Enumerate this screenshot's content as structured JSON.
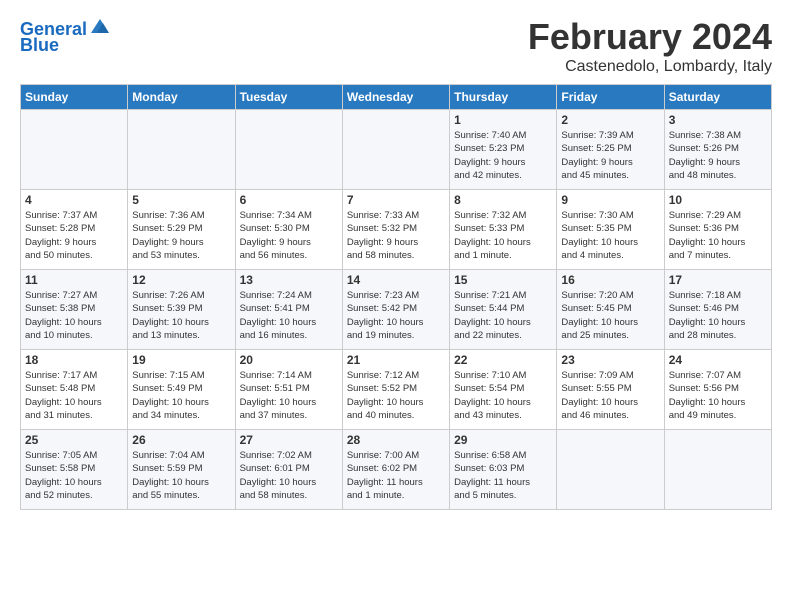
{
  "header": {
    "logo_line1": "General",
    "logo_line2": "Blue",
    "month_title": "February 2024",
    "location": "Castenedolo, Lombardy, Italy"
  },
  "weekdays": [
    "Sunday",
    "Monday",
    "Tuesday",
    "Wednesday",
    "Thursday",
    "Friday",
    "Saturday"
  ],
  "weeks": [
    [
      {
        "day": "",
        "info": ""
      },
      {
        "day": "",
        "info": ""
      },
      {
        "day": "",
        "info": ""
      },
      {
        "day": "",
        "info": ""
      },
      {
        "day": "1",
        "info": "Sunrise: 7:40 AM\nSunset: 5:23 PM\nDaylight: 9 hours\nand 42 minutes."
      },
      {
        "day": "2",
        "info": "Sunrise: 7:39 AM\nSunset: 5:25 PM\nDaylight: 9 hours\nand 45 minutes."
      },
      {
        "day": "3",
        "info": "Sunrise: 7:38 AM\nSunset: 5:26 PM\nDaylight: 9 hours\nand 48 minutes."
      }
    ],
    [
      {
        "day": "4",
        "info": "Sunrise: 7:37 AM\nSunset: 5:28 PM\nDaylight: 9 hours\nand 50 minutes."
      },
      {
        "day": "5",
        "info": "Sunrise: 7:36 AM\nSunset: 5:29 PM\nDaylight: 9 hours\nand 53 minutes."
      },
      {
        "day": "6",
        "info": "Sunrise: 7:34 AM\nSunset: 5:30 PM\nDaylight: 9 hours\nand 56 minutes."
      },
      {
        "day": "7",
        "info": "Sunrise: 7:33 AM\nSunset: 5:32 PM\nDaylight: 9 hours\nand 58 minutes."
      },
      {
        "day": "8",
        "info": "Sunrise: 7:32 AM\nSunset: 5:33 PM\nDaylight: 10 hours\nand 1 minute."
      },
      {
        "day": "9",
        "info": "Sunrise: 7:30 AM\nSunset: 5:35 PM\nDaylight: 10 hours\nand 4 minutes."
      },
      {
        "day": "10",
        "info": "Sunrise: 7:29 AM\nSunset: 5:36 PM\nDaylight: 10 hours\nand 7 minutes."
      }
    ],
    [
      {
        "day": "11",
        "info": "Sunrise: 7:27 AM\nSunset: 5:38 PM\nDaylight: 10 hours\nand 10 minutes."
      },
      {
        "day": "12",
        "info": "Sunrise: 7:26 AM\nSunset: 5:39 PM\nDaylight: 10 hours\nand 13 minutes."
      },
      {
        "day": "13",
        "info": "Sunrise: 7:24 AM\nSunset: 5:41 PM\nDaylight: 10 hours\nand 16 minutes."
      },
      {
        "day": "14",
        "info": "Sunrise: 7:23 AM\nSunset: 5:42 PM\nDaylight: 10 hours\nand 19 minutes."
      },
      {
        "day": "15",
        "info": "Sunrise: 7:21 AM\nSunset: 5:44 PM\nDaylight: 10 hours\nand 22 minutes."
      },
      {
        "day": "16",
        "info": "Sunrise: 7:20 AM\nSunset: 5:45 PM\nDaylight: 10 hours\nand 25 minutes."
      },
      {
        "day": "17",
        "info": "Sunrise: 7:18 AM\nSunset: 5:46 PM\nDaylight: 10 hours\nand 28 minutes."
      }
    ],
    [
      {
        "day": "18",
        "info": "Sunrise: 7:17 AM\nSunset: 5:48 PM\nDaylight: 10 hours\nand 31 minutes."
      },
      {
        "day": "19",
        "info": "Sunrise: 7:15 AM\nSunset: 5:49 PM\nDaylight: 10 hours\nand 34 minutes."
      },
      {
        "day": "20",
        "info": "Sunrise: 7:14 AM\nSunset: 5:51 PM\nDaylight: 10 hours\nand 37 minutes."
      },
      {
        "day": "21",
        "info": "Sunrise: 7:12 AM\nSunset: 5:52 PM\nDaylight: 10 hours\nand 40 minutes."
      },
      {
        "day": "22",
        "info": "Sunrise: 7:10 AM\nSunset: 5:54 PM\nDaylight: 10 hours\nand 43 minutes."
      },
      {
        "day": "23",
        "info": "Sunrise: 7:09 AM\nSunset: 5:55 PM\nDaylight: 10 hours\nand 46 minutes."
      },
      {
        "day": "24",
        "info": "Sunrise: 7:07 AM\nSunset: 5:56 PM\nDaylight: 10 hours\nand 49 minutes."
      }
    ],
    [
      {
        "day": "25",
        "info": "Sunrise: 7:05 AM\nSunset: 5:58 PM\nDaylight: 10 hours\nand 52 minutes."
      },
      {
        "day": "26",
        "info": "Sunrise: 7:04 AM\nSunset: 5:59 PM\nDaylight: 10 hours\nand 55 minutes."
      },
      {
        "day": "27",
        "info": "Sunrise: 7:02 AM\nSunset: 6:01 PM\nDaylight: 10 hours\nand 58 minutes."
      },
      {
        "day": "28",
        "info": "Sunrise: 7:00 AM\nSunset: 6:02 PM\nDaylight: 11 hours\nand 1 minute."
      },
      {
        "day": "29",
        "info": "Sunrise: 6:58 AM\nSunset: 6:03 PM\nDaylight: 11 hours\nand 5 minutes."
      },
      {
        "day": "",
        "info": ""
      },
      {
        "day": "",
        "info": ""
      }
    ]
  ]
}
